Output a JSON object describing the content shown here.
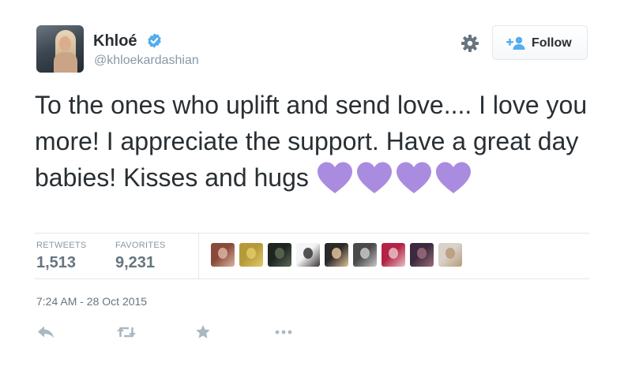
{
  "user": {
    "name": "Khloé",
    "handle": "@khloekardashian",
    "verified": true
  },
  "follow_button": {
    "label": "Follow"
  },
  "tweet": {
    "text": "To the ones who uplift and send love.... I love you more! I appreciate the support. Have a great day babies! Kisses and hugs",
    "emoji": [
      "purple-heart",
      "purple-heart",
      "purple-heart",
      "purple-heart"
    ],
    "timestamp": "7:24 AM - 28 Oct 2015"
  },
  "stats": {
    "retweets_label": "RETWEETS",
    "retweets": "1,513",
    "favorites_label": "FAVORITES",
    "favorites": "9,231"
  },
  "favoriters": [
    {
      "name": "favoriter-avatar-1",
      "colors": [
        "#8a4a3a",
        "#d9b4a0"
      ]
    },
    {
      "name": "favoriter-avatar-2",
      "colors": [
        "#b49a3a",
        "#e0c968"
      ]
    },
    {
      "name": "favoriter-avatar-3",
      "colors": [
        "#1e2420",
        "#5b6a56"
      ]
    },
    {
      "name": "favoriter-avatar-4",
      "colors": [
        "#f4f4f4",
        "#3a3636"
      ]
    },
    {
      "name": "favoriter-avatar-5",
      "colors": [
        "#2b2a2a",
        "#e3c29a"
      ]
    },
    {
      "name": "favoriter-avatar-6",
      "colors": [
        "#4a4a4a",
        "#c8c8c8"
      ]
    },
    {
      "name": "favoriter-avatar-7",
      "colors": [
        "#b32444",
        "#e8c0c8"
      ]
    },
    {
      "name": "favoriter-avatar-8",
      "colors": [
        "#3b2a3f",
        "#9a6b78"
      ]
    },
    {
      "name": "favoriter-avatar-9",
      "colors": [
        "#d8d2c8",
        "#b89a78"
      ]
    }
  ],
  "colors": {
    "heart": "#a98ce0",
    "verified": "#55acee",
    "follow_icon": "#55acee",
    "muted": "#8899a6",
    "action_icon": "#aab8c2"
  },
  "icons": {
    "settings": "gear-icon",
    "reply": "reply-icon",
    "retweet": "retweet-icon",
    "favorite": "star-icon",
    "more": "more-icon"
  }
}
